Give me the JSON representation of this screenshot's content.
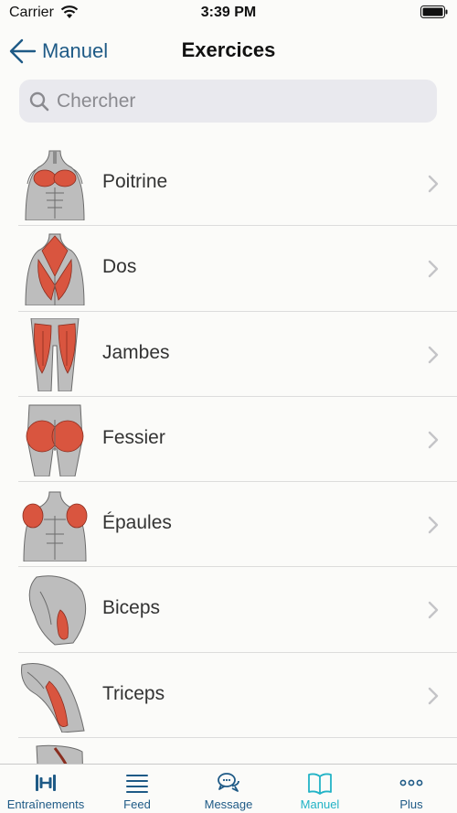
{
  "status_bar": {
    "carrier": "Carrier",
    "time": "3:39 PM"
  },
  "nav": {
    "back_label": "Manuel",
    "title": "Exercices"
  },
  "search": {
    "placeholder": "Chercher"
  },
  "exercises": [
    {
      "label": "Poitrine",
      "icon": "chest-muscle-icon"
    },
    {
      "label": "Dos",
      "icon": "back-muscle-icon"
    },
    {
      "label": "Jambes",
      "icon": "legs-muscle-icon"
    },
    {
      "label": "Fessier",
      "icon": "glutes-muscle-icon"
    },
    {
      "label": "Épaules",
      "icon": "shoulders-muscle-icon"
    },
    {
      "label": "Biceps",
      "icon": "biceps-muscle-icon"
    },
    {
      "label": "Triceps",
      "icon": "triceps-muscle-icon"
    }
  ],
  "tabs": [
    {
      "label": "Entraînements",
      "icon": "dumbbell-icon",
      "active": false
    },
    {
      "label": "Feed",
      "icon": "feed-list-icon",
      "active": false
    },
    {
      "label": "Message",
      "icon": "chat-bubbles-icon",
      "active": false
    },
    {
      "label": "Manuel",
      "icon": "book-icon",
      "active": true
    },
    {
      "label": "Plus",
      "icon": "more-dots-icon",
      "active": false
    }
  ],
  "colors": {
    "accent": "#1e5a86",
    "active_tab": "#22b3c6",
    "muscle": "#d9553f"
  }
}
